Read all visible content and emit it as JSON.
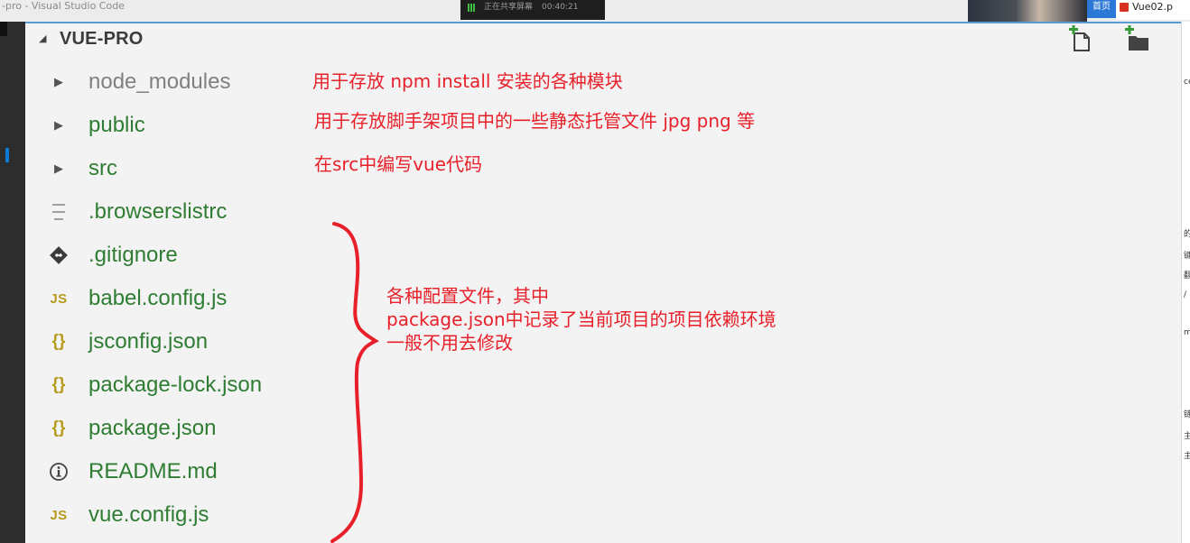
{
  "window": {
    "title": "-pro - Visual Studio Code",
    "share_bar_text": "正在共享屏幕",
    "share_bar_time": "00:40:21",
    "browser_home_tab": "首页",
    "browser_tab_title": "Vue02.p"
  },
  "right_sliver": [
    "ce",
    "的",
    "键",
    "翻",
    "/",
    "ml",
    "链",
    "主",
    "主"
  ],
  "explorer": {
    "project_title": "VUE-PRO",
    "collapse_icon": "triangle-down",
    "actions": {
      "new_file_icon": "new-file",
      "new_folder_icon": "new-folder"
    },
    "items": [
      {
        "label": "node_modules",
        "icon": "chevron-right",
        "kind": "folder",
        "color": "#808080"
      },
      {
        "label": "public",
        "icon": "chevron-right",
        "kind": "folder",
        "color": "#2e7d32"
      },
      {
        "label": "src",
        "icon": "chevron-right",
        "kind": "folder",
        "color": "#2e7d32"
      },
      {
        "label": ".browserslistrc",
        "icon": "lines",
        "kind": "file",
        "color": "#2e7d32"
      },
      {
        "label": ".gitignore",
        "icon": "git-diamond",
        "kind": "file",
        "color": "#2e7d32"
      },
      {
        "label": "babel.config.js",
        "icon": "JS",
        "kind": "file",
        "color": "#2e7d32"
      },
      {
        "label": "jsconfig.json",
        "icon": "{}",
        "kind": "file",
        "color": "#2e7d32"
      },
      {
        "label": "package-lock.json",
        "icon": "{}",
        "kind": "file",
        "color": "#2e7d32"
      },
      {
        "label": "package.json",
        "icon": "{}",
        "kind": "file",
        "color": "#2e7d32"
      },
      {
        "label": "README.md",
        "icon": "info-circle",
        "kind": "file",
        "color": "#2e7d32"
      },
      {
        "label": "vue.config.js",
        "icon": "JS",
        "kind": "file",
        "color": "#2e7d32"
      }
    ]
  },
  "annotations": {
    "node_modules_note": "用于存放 npm install 安装的各种模块",
    "public_note": "用于存放脚手架项目中的一些静态托管文件   jpg png 等",
    "src_note": "在src中编写vue代码",
    "config_line1": "各种配置文件，其中",
    "config_line2": "package.json中记录了当前项目的项目依赖环境",
    "config_line3": "一般不用去修改"
  },
  "colors": {
    "annotation": "#e8202a",
    "folder_muted": "#808080",
    "git_green": "#2e7d32",
    "icon_gold": "#b79a1f",
    "new_item_green": "#3a9a3a"
  }
}
